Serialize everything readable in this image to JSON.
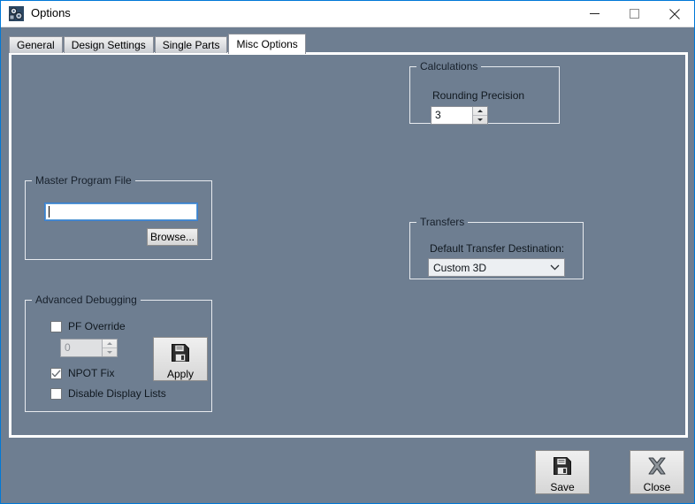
{
  "window": {
    "title": "Options",
    "icon": "gears-icon",
    "accent_color": "#0078d7",
    "background_color": "#6e7e91",
    "controls": {
      "minimize": "minimize-icon",
      "maximize": "maximize-icon",
      "close": "close-icon"
    }
  },
  "tabs": [
    {
      "label": "General",
      "active": false
    },
    {
      "label": "Design Settings",
      "active": false
    },
    {
      "label": "Single Parts",
      "active": false
    },
    {
      "label": "Misc Options",
      "active": true
    }
  ],
  "groups": {
    "calculations": {
      "label": "Calculations",
      "rounding_precision_label": "Rounding Precision",
      "rounding_precision_value": "3"
    },
    "master_program_file": {
      "label": "Master Program File",
      "path_value": "",
      "path_placeholder": "",
      "browse_label": "Browse..."
    },
    "transfers": {
      "label": "Transfers",
      "destination_label": "Default Transfer Destination:",
      "destination_value": "Custom 3D",
      "destination_options": [
        "Custom 3D"
      ]
    },
    "advanced_debugging": {
      "label": "Advanced Debugging",
      "pf_override_label": "PF Override",
      "pf_override_checked": false,
      "pf_override_value": "0",
      "pf_override_enabled": false,
      "npot_fix_label": "NPOT Fix",
      "npot_fix_checked": true,
      "disable_display_lists_label": "Disable Display Lists",
      "disable_display_lists_checked": false,
      "apply_label": "Apply",
      "apply_icon": "floppy-disk-icon"
    }
  },
  "footer": {
    "save_label": "Save",
    "save_icon": "floppy-disk-icon",
    "close_label": "Close",
    "close_icon": "x-mark-icon"
  }
}
